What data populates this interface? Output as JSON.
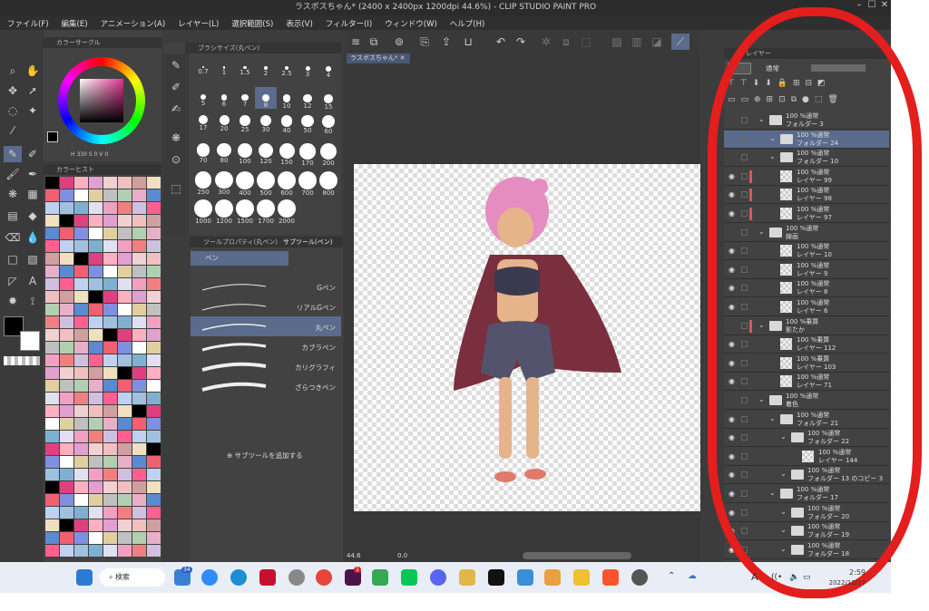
{
  "window": {
    "title": "ラスボスちゃん* (2400 x 2400px 1200dpi 44.6%) - CLIP STUDIO PAINT PRO"
  },
  "menu": [
    "ファイル(F)",
    "編集(E)",
    "アニメーション(A)",
    "レイヤー(L)",
    "選択範囲(S)",
    "表示(V)",
    "フィルター(I)",
    "ウィンドウ(W)",
    "ヘルプ(H)"
  ],
  "color_panel": {
    "tab": "カラーサークル",
    "readout": [
      "H",
      "330",
      "S",
      "0",
      "V",
      "0"
    ]
  },
  "history_panel": {
    "tab": "カラーヒスト"
  },
  "brush_size": {
    "tab": "ブラシサイズ(丸ペン)",
    "sizes": [
      "0.7",
      "1",
      "1.5",
      "2",
      "2.5",
      "3",
      "4",
      "5",
      "6",
      "7",
      "8",
      "10",
      "12",
      "15",
      "17",
      "20",
      "25",
      "30",
      "40",
      "50",
      "60",
      "70",
      "80",
      "100",
      "120",
      "150",
      "170",
      "200",
      "250",
      "300",
      "400",
      "500",
      "600",
      "700",
      "800",
      "1000",
      "1200",
      "1500",
      "1700",
      "2000"
    ]
  },
  "subtool": {
    "tab_prop": "ツールプロパティ(丸ペン)",
    "tab_sub": "サブツール(ペン)",
    "group": "ペン",
    "items": [
      "Gペン",
      "リアルGペン",
      "丸ペン",
      "カブラペン",
      "カリグラフィ",
      "ざらつきペン"
    ],
    "add_label": "サブツールを追加する"
  },
  "canvas": {
    "tab": "ラスボスちゃん*",
    "zoom": "44.6",
    "angle": "0.0"
  },
  "layer_panel": {
    "tab": "レイヤー",
    "blend": "通常",
    "rows": [
      {
        "l1": "100 %通常",
        "l2": "フォルダー 3"
      },
      {
        "l1": "100 %通常",
        "l2": "フォルダー 24"
      },
      {
        "l1": "100 %通常",
        "l2": "フォルダー 10"
      },
      {
        "l1": "100 %通常",
        "l2": "レイヤー 99"
      },
      {
        "l1": "100 %通常",
        "l2": "レイヤー 98"
      },
      {
        "l1": "100 %通常",
        "l2": "レイヤー 97"
      },
      {
        "l1": "100 %通常",
        "l2": "線画"
      },
      {
        "l1": "100 %通常",
        "l2": "レイヤー 10"
      },
      {
        "l1": "100 %通常",
        "l2": "レイヤー 9"
      },
      {
        "l1": "100 %通常",
        "l2": "レイヤー 8"
      },
      {
        "l1": "100 %通常",
        "l2": "レイヤー 6"
      },
      {
        "l1": "100 %乗算",
        "l2": "影たか"
      },
      {
        "l1": "100 %乗算",
        "l2": "レイヤー 112"
      },
      {
        "l1": "100 %乗算",
        "l2": "レイヤー 103"
      },
      {
        "l1": "100 %通常",
        "l2": "レイヤー 71"
      },
      {
        "l1": "100 %通常",
        "l2": "着色"
      },
      {
        "l1": "100 %通常",
        "l2": "フォルダー 21"
      },
      {
        "l1": "100 %通常",
        "l2": "フォルダー 22"
      },
      {
        "l1": "100 %通常",
        "l2": "レイヤー 144"
      },
      {
        "l1": "100 %通常",
        "l2": "フォルダー 13 のコピー 3"
      },
      {
        "l1": "100 %通常",
        "l2": "フォルダー 17"
      },
      {
        "l1": "100 %通常",
        "l2": "フォルダー 20"
      },
      {
        "l1": "100 %通常",
        "l2": "フォルダー 19"
      },
      {
        "l1": "100 %通常",
        "l2": "フォルダー 18"
      }
    ]
  },
  "taskbar": {
    "search": "検索",
    "badge_mail": "34",
    "badge_slack": "1",
    "time": "2:59",
    "date": "2022/12/17",
    "ime": "A"
  }
}
